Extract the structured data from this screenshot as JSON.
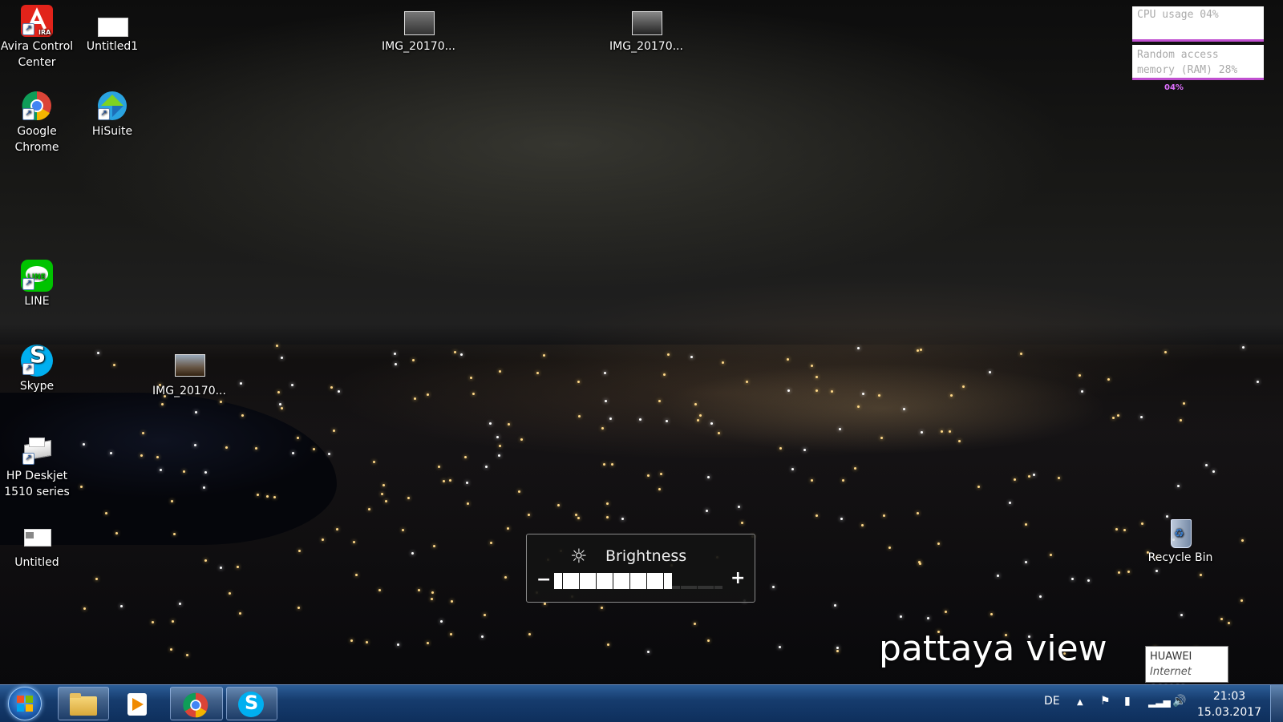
{
  "desktop": {
    "icons": [
      {
        "label": "Avira Control Center",
        "icon": "avira-icon"
      },
      {
        "label": "Untitled1",
        "icon": "document-icon"
      },
      {
        "label": "IMG_20170...",
        "icon": "photo-icon"
      },
      {
        "label": "IMG_20170...",
        "icon": "photo-icon"
      },
      {
        "label": "Google Chrome",
        "icon": "chrome-icon"
      },
      {
        "label": "HiSuite",
        "icon": "hisuite-icon"
      },
      {
        "label": "LINE",
        "icon": "line-icon"
      },
      {
        "label": "Skype",
        "icon": "skype-icon"
      },
      {
        "label": "IMG_20170...",
        "icon": "photo-icon"
      },
      {
        "label": "HP Deskjet 1510 series",
        "icon": "printer-icon"
      },
      {
        "label": "Untitled",
        "icon": "document-icon"
      },
      {
        "label": "Recycle Bin",
        "icon": "recycle-bin-icon"
      }
    ]
  },
  "widgets": {
    "cpu_label": "CPU usage 04%",
    "ram_label_line1": "Random access",
    "ram_label_line2": "memory (RAM) 28%",
    "cpu_small": "04%"
  },
  "brightness": {
    "title": "Brightness",
    "minus": "−",
    "plus": "+",
    "level": 0.68,
    "segments": 20
  },
  "watermark": "pattaya view",
  "tooltip": {
    "title": "HUAWEI",
    "subtitle": "Internet access"
  },
  "taskbar": {
    "language": "DE",
    "time": "21:03",
    "date": "15.03.2017",
    "pinned": [
      "file-explorer-icon",
      "media-player-icon",
      "chrome-icon",
      "skype-icon"
    ]
  },
  "colors": {
    "taskbar": "#163c6e",
    "widget_accent": "#c050d0",
    "skype": "#00aff0",
    "line": "#00c300",
    "avira": "#e2231a"
  }
}
